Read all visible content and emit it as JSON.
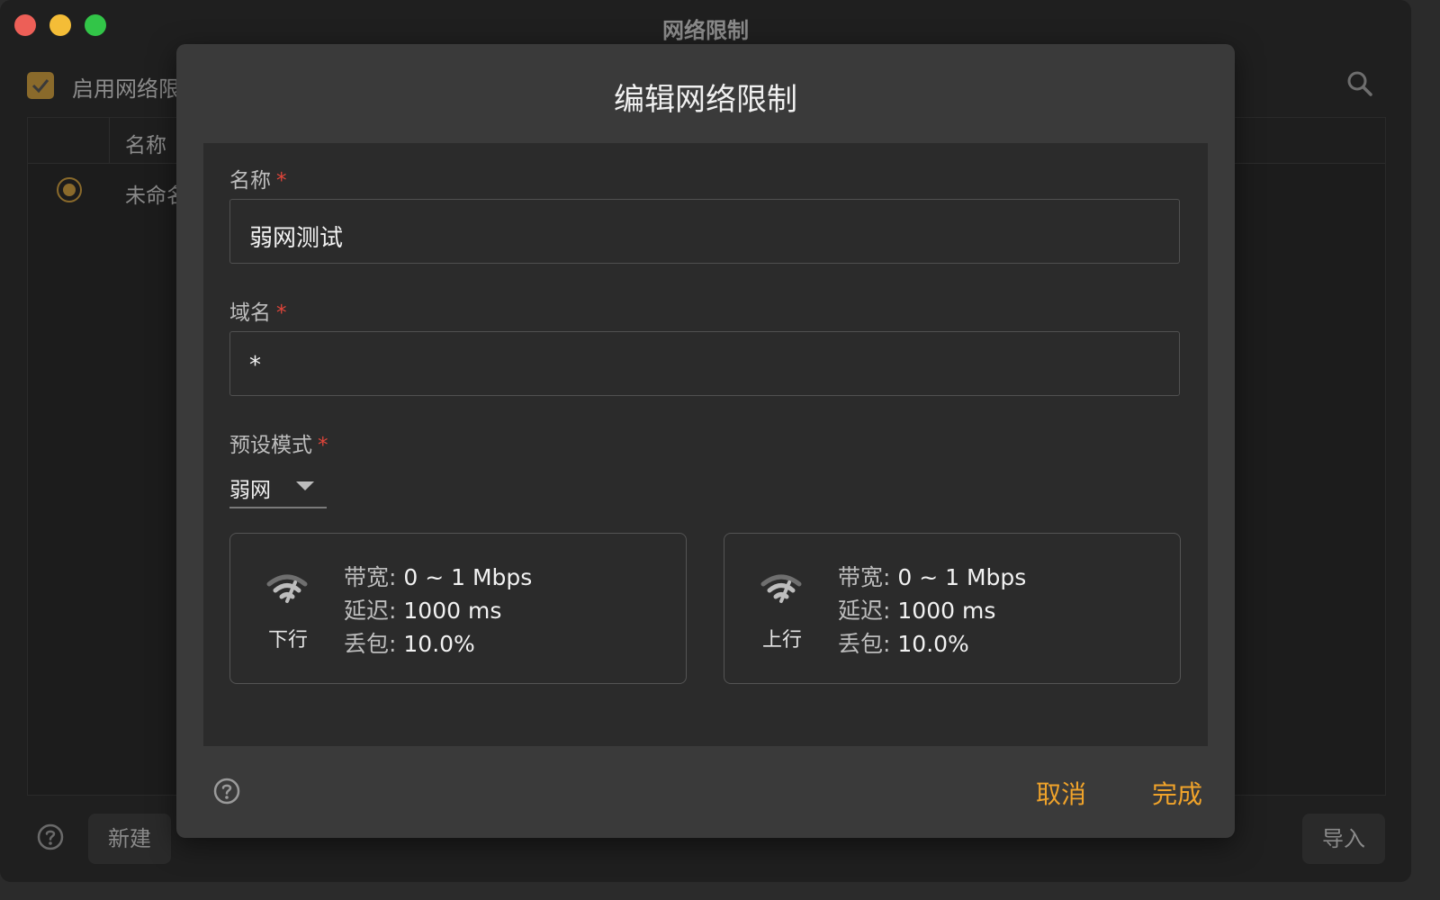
{
  "window": {
    "title": "网络限制"
  },
  "background": {
    "enable_label": "启用网络限",
    "column_name": "名称",
    "row_name": "未命名",
    "new_button": "新建",
    "import_button": "导入"
  },
  "dialog": {
    "title": "编辑网络限制",
    "name_label": "名称",
    "name_value": "弱网测试",
    "domain_label": "域名",
    "domain_value": "*",
    "preset_label": "预设模式",
    "preset_value": "弱网",
    "required_mark": "*",
    "downlink": {
      "direction": "下行",
      "bandwidth_key": "带宽:",
      "bandwidth_value": "0 ~ 1 Mbps",
      "latency_key": "延迟:",
      "latency_value": "1000 ms",
      "loss_key": "丢包:",
      "loss_value": "10.0%"
    },
    "uplink": {
      "direction": "上行",
      "bandwidth_key": "带宽:",
      "bandwidth_value": "0 ~ 1 Mbps",
      "latency_key": "延迟:",
      "latency_value": "1000 ms",
      "loss_key": "丢包:",
      "loss_value": "10.0%"
    },
    "cancel_label": "取消",
    "done_label": "完成"
  },
  "colors": {
    "accent": "#f0a32a",
    "required": "#e0453a",
    "dialog_bg": "#3a3a3a",
    "body_bg": "#2b2b2b"
  },
  "icons": [
    "search-icon",
    "help-icon",
    "wifi-weak-icon",
    "checkbox-checked-icon"
  ]
}
